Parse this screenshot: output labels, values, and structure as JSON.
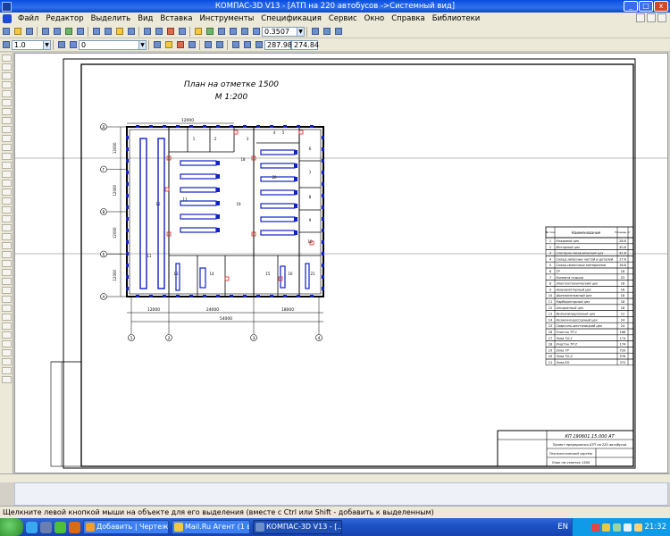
{
  "window": {
    "title": "КОМПАС-3D V13 - [АТП на 220 автобусов ->Системный вид]",
    "buttons": [
      "_",
      "□",
      "x"
    ]
  },
  "menubar": {
    "items": [
      "Файл",
      "Редактор",
      "Выделить",
      "Вид",
      "Вставка",
      "Инструменты",
      "Спецификация",
      "Сервис",
      "Окно",
      "Справка",
      "Библиотеки"
    ]
  },
  "toolbar1": {
    "zoom_value": "0.3507"
  },
  "toolbar2": {
    "line_width": "1.0",
    "layer_value": "0",
    "coord_x": "287.98",
    "coord_y": "274.84"
  },
  "drawing": {
    "plan_title": "План на отметке 1500",
    "scale": "М 1:200",
    "dim_top": "12000",
    "dim_bottom_1": "12000",
    "dim_bottom_2": "24000",
    "dim_bottom_3": "18000",
    "dim_total": "54000",
    "axis_rows": [
      "Д",
      "Г",
      "В",
      "Б",
      "А"
    ],
    "axis_cols": [
      "1",
      "2",
      "3",
      "4"
    ],
    "row_dims": [
      "12000",
      "12000",
      "12000",
      "12000"
    ],
    "room_numbers": [
      "1",
      "2",
      "3",
      "4",
      "5",
      "6",
      "7",
      "8",
      "9",
      "10",
      "11",
      "12",
      "13",
      "14",
      "15",
      "16",
      "17",
      "18",
      "19",
      "20",
      "21"
    ],
    "code_main": "КП 190601.15.000 АТ",
    "code_sub": "Проект предприятия АТП на 220 автобусов",
    "stamp_lines": [
      "План на отметке 1500",
      "Технологический чертёж"
    ]
  },
  "room_table": {
    "header_num": "№ пом",
    "header_name": "Наименование",
    "header_area": "Площадь, м²",
    "rows": [
      {
        "n": "1",
        "name": "Кладовой цех",
        "area": "28.6"
      },
      {
        "n": "2",
        "name": "Моторный цех",
        "area": "40.8"
      },
      {
        "n": "3",
        "name": "Слесарно-механический цех",
        "area": "42.8"
      },
      {
        "n": "4",
        "name": "Склад запасных частей и деталей",
        "area": "17.6"
      },
      {
        "n": "5",
        "name": "Склад смазочных материалов",
        "area": "18.8"
      },
      {
        "n": "6",
        "name": "ТР",
        "area": "18"
      },
      {
        "n": "7",
        "name": "Комната отдыха",
        "area": "23"
      },
      {
        "n": "8",
        "name": "Электротехнический цех",
        "area": "18"
      },
      {
        "n": "9",
        "name": "Аккумуляторный цех",
        "area": "16"
      },
      {
        "n": "10",
        "name": "Шиномонтажный цех",
        "area": "18"
      },
      {
        "n": "11",
        "name": "Карбюраторный цех",
        "area": "18"
      },
      {
        "n": "12",
        "name": "Аппаратный цех",
        "area": "18"
      },
      {
        "n": "13",
        "name": "Вулканизационный цех",
        "area": "12"
      },
      {
        "n": "14",
        "name": "Кузнечно-рессорный цех",
        "area": "24"
      },
      {
        "n": "15",
        "name": "Сварочно-жестяницкий цех",
        "area": "24"
      },
      {
        "n": "16",
        "name": "Участок ТР-1",
        "area": "186"
      },
      {
        "n": "17",
        "name": "Зона ТО-1",
        "area": "174"
      },
      {
        "n": "18",
        "name": "Участок ТР-2",
        "area": "174"
      },
      {
        "n": "19",
        "name": "Зона ТР",
        "area": "720"
      },
      {
        "n": "20",
        "name": "Зона ТО-2",
        "area": "576"
      },
      {
        "n": "21",
        "name": "Зона ЕО",
        "area": "372"
      }
    ]
  },
  "status": {
    "text": "Щелкните левой кнопкой мыши на объекте для его выделения (вместе с Ctrl или Shift - добавить к выделенным)"
  },
  "taskbar": {
    "tasks": [
      "Добавить | Чертежи...",
      "Mail.Ru Агент (1 вкл...",
      "КОМПАС-3D V13 - [..."
    ],
    "lang": "EN",
    "clock": "21:32"
  }
}
